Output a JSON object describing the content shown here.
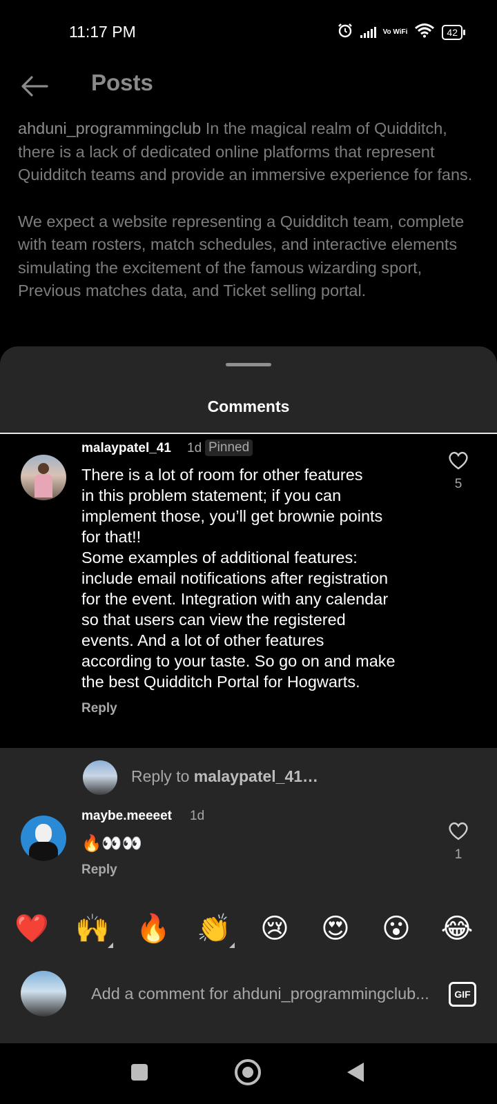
{
  "status_bar": {
    "time": "11:17 PM",
    "network_label": "Vo WiFi",
    "battery": "42"
  },
  "header": {
    "title": "Posts"
  },
  "caption": {
    "username": "ahduni_programmingclub",
    "paragraph1": "In the magical realm of Quidditch, there is a lack of dedicated online platforms that represent Quidditch teams and provide an immersive experience for fans.",
    "paragraph2": "We expect a website representing a Quidditch team, complete with team rosters, match schedules, and interactive elements simulating the excitement of the famous wizarding sport, Previous matches data, and Ticket selling portal."
  },
  "comments_sheet": {
    "title": "Comments",
    "pinned_comment": {
      "username": "malaypatel_41",
      "time": "1d",
      "pinned_label": "Pinned",
      "text_lines": [
        "There is a lot of room for other features",
        "in this problem statement; if you can",
        "implement those, you’ll get brownie points",
        "for that!!",
        "Some examples of additional features:",
        "include email notifications after registration",
        "for the event. Integration with any calendar",
        "so that users can view the registered",
        "events. And a lot of other features",
        "according to your taste. So go on and make",
        "the best Quidditch Portal for Hogwarts."
      ],
      "reply_label": "Reply",
      "like_count": "5"
    },
    "reply_prompt": {
      "prefix": "Reply to ",
      "target": "malaypatel_41…"
    },
    "comment2": {
      "username": "maybe.meeeet",
      "time": "1d",
      "text": "🔥👀👀",
      "reply_label": "Reply",
      "like_count": "1"
    },
    "quick_reactions": [
      "❤️",
      "🙌",
      "🔥",
      "👏",
      "😢",
      "😍",
      "😮",
      "😂"
    ],
    "add_comment": {
      "placeholder": "Add a comment for ahduni_programmingclub...",
      "gif_label": "GIF"
    }
  }
}
